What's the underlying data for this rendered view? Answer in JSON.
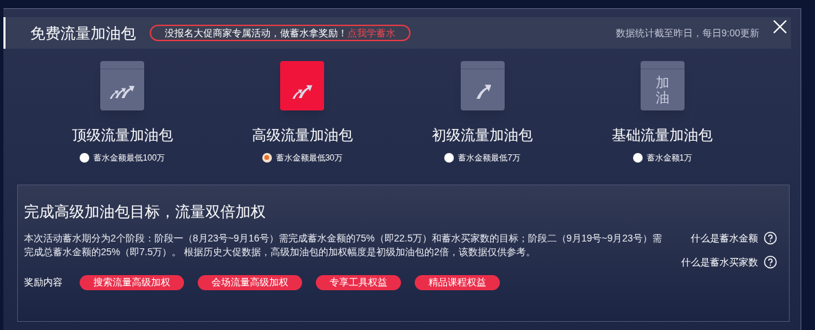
{
  "header": {
    "title": "免费流量加油包",
    "notice": "没报名大促商家专属活动，做蓄水拿奖励！",
    "notice_link": "点我学蓄水",
    "update_note": "数据统计截至昨日，每日9:00更新"
  },
  "packages": [
    {
      "kind": "arrows3",
      "name": "顶级流量加油包",
      "requirement": "蓄水金额最低100万",
      "selected": false
    },
    {
      "kind": "arrows2",
      "name": "高级流量加油包",
      "requirement": "蓄水金额最低30万",
      "selected": true
    },
    {
      "kind": "arrow1",
      "name": "初级流量加油包",
      "requirement": "蓄水金额最低7万",
      "selected": false
    },
    {
      "kind": "text",
      "icon_text": "加油",
      "name": "基础流量加油包",
      "requirement": "蓄水金额1万",
      "selected": false
    }
  ],
  "detail": {
    "title": "完成高级加油包目标，流量双倍加权",
    "description": "本次活动蓄水期分为2个阶段：阶段一（8月23号~9月16号）需完成蓄水金额的75%（即22.5万）和蓄水买家数的目标；阶段二（9月19号~9月23号）需完成总蓄水金额的25%（即7.5万）。 根据历史大促数据，高级加油包的加权幅度是初级加油包的2倍，该数据仅供参考。",
    "help_links": [
      "什么是蓄水金额",
      "什么是蓄水买家数"
    ],
    "rewards_label": "奖励内容",
    "rewards": [
      "搜索流量高级加权",
      "会场流量高级加权",
      "专享工具权益",
      "精品课程权益"
    ]
  }
}
